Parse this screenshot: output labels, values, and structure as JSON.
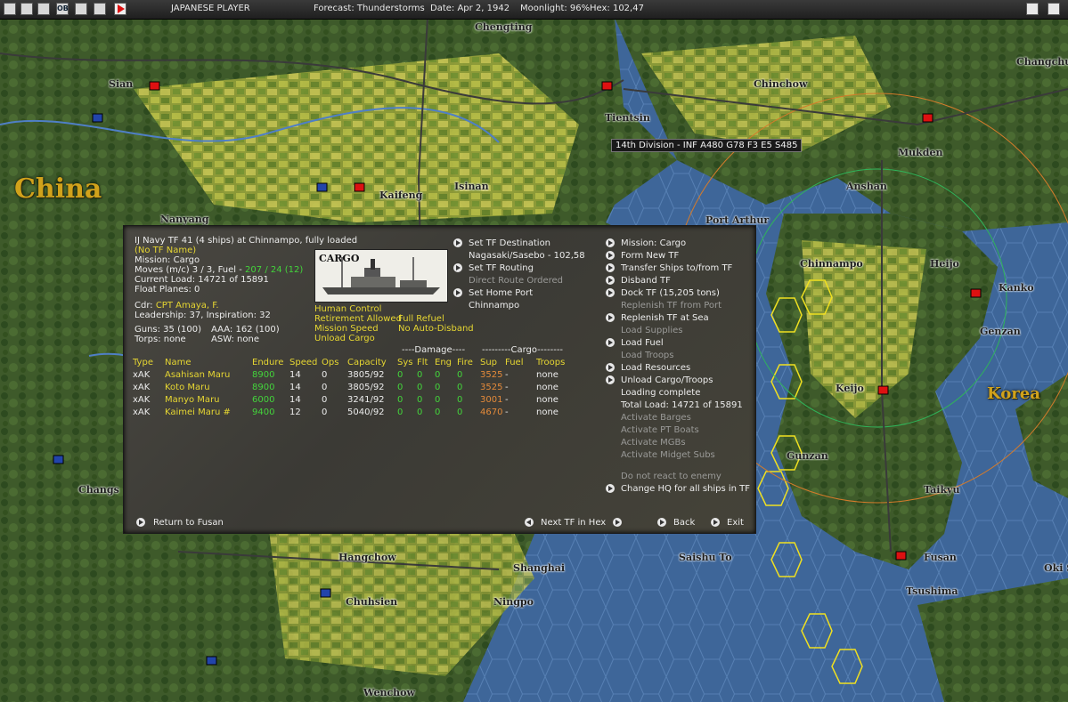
{
  "topbar": {
    "player": "JAPANESE PLAYER",
    "forecast": "Forecast: Thunderstorms",
    "date": "Date: Apr 2, 1942",
    "moonlight": "Moonlight: 96%",
    "hex": "Hex: 102,47",
    "icons": [
      "map-icon",
      "save-icon",
      "globe-icon",
      "ob-icon",
      "report-icon",
      "window-icon",
      "turn-arrow-icon"
    ],
    "icon_labels": [
      "",
      "",
      "",
      "OB",
      "",
      "",
      ""
    ]
  },
  "map": {
    "cities": [
      "Sian",
      "Chengting",
      "Chinchow",
      "Changchu",
      "Tientsin",
      "Mukden",
      "Isinan",
      "Kaifeng",
      "Anshan",
      "Nanyang",
      "Port Arthur",
      "Chinnampo",
      "Heijo",
      "Kanko",
      "Genzan",
      "Keijo",
      "Gunzan",
      "Taikyu",
      "Hangchow",
      "Shanghai",
      "Saishu To",
      "Fusan",
      "Tsushima",
      "Chuhsien",
      "Ningpo",
      "Wenchow",
      "Changs",
      "Oki S"
    ],
    "regions": [
      "China",
      "Korea"
    ],
    "unit_tooltip": "14th Division - INF   A480 G78 F3 E5 S485"
  },
  "dialog": {
    "title": "IJ Navy TF 41 (4 ships) at Chinnampo, fully loaded",
    "tf_name": "(No TF Name)",
    "mission": "Mission: Cargo",
    "moves_prefix": "Moves (m/c) 3 / 3, Fuel - ",
    "moves_fuel": "207 / 24 (12)",
    "current_load": "Current Load: 14721 of 15891",
    "float_planes": "Float Planes: 0",
    "cdr_label": "Cdr:",
    "cdr_name": "CPT Amaya, F.",
    "leadership": "Leadership: 37, Inspiration: 32",
    "guns": "Guns: 35 (100)",
    "aaa": "AAA: 162 (100)",
    "torps": "Torps: none",
    "asw": "ASW: none",
    "ship_picture_label": "CARGO",
    "status": {
      "human_control": "Human Control",
      "retirement": "Retirement Allowed",
      "full_refuel": "Full Refuel",
      "mission_speed": "Mission Speed",
      "no_auto_disband": "No Auto-Disband",
      "unload_cargo": "Unload Cargo"
    },
    "mid_menu": {
      "set_destination": "Set TF Destination",
      "destination_value": "Nagasaki/Sasebo - 102,58",
      "set_routing": "Set TF Routing",
      "direct_route": "Direct Route Ordered",
      "set_home_port": "Set Home Port",
      "home_port_value": "Chinnampo"
    },
    "right_menu": [
      {
        "label": "Mission: Cargo",
        "arrow": true,
        "dim": false
      },
      {
        "label": "Form New TF",
        "arrow": true,
        "dim": false
      },
      {
        "label": "Transfer Ships to/from TF",
        "arrow": true,
        "dim": false
      },
      {
        "label": "Disband TF",
        "arrow": true,
        "dim": false
      },
      {
        "label": "Dock TF (15,205 tons)",
        "arrow": true,
        "dim": false
      },
      {
        "label": "Replenish TF from Port",
        "arrow": false,
        "dim": true
      },
      {
        "label": "Replenish TF at Sea",
        "arrow": true,
        "dim": false
      },
      {
        "label": "Load Supplies",
        "arrow": false,
        "dim": true
      },
      {
        "label": "Load Fuel",
        "arrow": true,
        "dim": false
      },
      {
        "label": "Load Troops",
        "arrow": false,
        "dim": true
      },
      {
        "label": "Load Resources",
        "arrow": true,
        "dim": false
      },
      {
        "label": "Unload Cargo/Troops",
        "arrow": true,
        "dim": false
      },
      {
        "label": "Loading complete",
        "arrow": false,
        "dim": false
      },
      {
        "label": "Total Load: 14721 of 15891",
        "arrow": false,
        "dim": false
      },
      {
        "label": "Activate Barges",
        "arrow": false,
        "dim": true
      },
      {
        "label": "Activate PT Boats",
        "arrow": false,
        "dim": true
      },
      {
        "label": "Activate MGBs",
        "arrow": false,
        "dim": true
      },
      {
        "label": "Activate Midget Subs",
        "arrow": false,
        "dim": true
      }
    ],
    "do_not_react": "Do not react to enemy",
    "change_hq": "Change HQ for all ships in TF",
    "group_headers": {
      "damage": "----Damage----",
      "cargo": "---------Cargo--------"
    },
    "columns": [
      "Type",
      "Name",
      "Endure",
      "Speed",
      "Ops",
      "Capacity",
      "Sys",
      "Flt",
      "Eng",
      "Fire",
      "Sup",
      "Fuel",
      "Troops"
    ],
    "ships": [
      {
        "type": "xAK",
        "name": "Asahisan Maru",
        "endure": "8900",
        "speed": "14",
        "ops": "0",
        "capacity": "3805/92",
        "sys": "0",
        "flt": "0",
        "eng": "0",
        "fire": "0",
        "sup": "3525",
        "fuel": "-",
        "troops": "none"
      },
      {
        "type": "xAK",
        "name": "Koto Maru",
        "endure": "8900",
        "speed": "14",
        "ops": "0",
        "capacity": "3805/92",
        "sys": "0",
        "flt": "0",
        "eng": "0",
        "fire": "0",
        "sup": "3525",
        "fuel": "-",
        "troops": "none"
      },
      {
        "type": "xAK",
        "name": "Manyo Maru",
        "endure": "6000",
        "speed": "14",
        "ops": "0",
        "capacity": "3241/92",
        "sys": "0",
        "flt": "0",
        "eng": "0",
        "fire": "0",
        "sup": "3001",
        "fuel": "-",
        "troops": "none"
      },
      {
        "type": "xAK",
        "name": "Kaimei Maru #",
        "endure": "9400",
        "speed": "12",
        "ops": "0",
        "capacity": "5040/92",
        "sys": "0",
        "flt": "0",
        "eng": "0",
        "fire": "0",
        "sup": "4670",
        "fuel": "-",
        "troops": "none"
      }
    ],
    "footer": {
      "return": "Return to Fusan",
      "next_tf": "Next TF in Hex",
      "back": "Back",
      "exit": "Exit"
    }
  }
}
